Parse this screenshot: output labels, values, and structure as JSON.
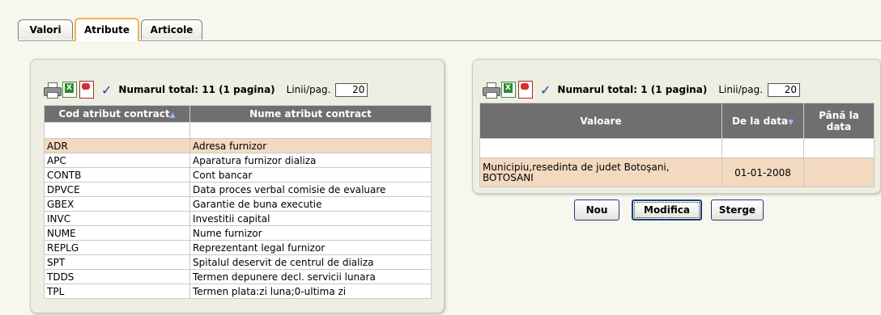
{
  "tabs": [
    {
      "label": "Valori",
      "active": false
    },
    {
      "label": "Atribute",
      "active": true
    },
    {
      "label": "Articole",
      "active": false
    }
  ],
  "left_panel": {
    "total_text": "Numarul total: 11 (1 pagina)",
    "lines_label": "Linii/pag.",
    "lines_value": "20",
    "columns": [
      "Cod atribut contract",
      "Nume atribut contract"
    ],
    "sort_icon": "sort-ascending-icon",
    "rows": [
      {
        "code": "ADR",
        "name": "Adresa furnizor",
        "selected": true
      },
      {
        "code": "APC",
        "name": "Aparatura furnizor dializa",
        "selected": false
      },
      {
        "code": "CONTB",
        "name": "Cont bancar",
        "selected": false
      },
      {
        "code": "DPVCE",
        "name": "Data proces verbal comisie de evaluare",
        "selected": false
      },
      {
        "code": "GBEX",
        "name": "Garantie de buna executie",
        "selected": false
      },
      {
        "code": "INVC",
        "name": "Investitii capital",
        "selected": false
      },
      {
        "code": "NUME",
        "name": "Nume furnizor",
        "selected": false
      },
      {
        "code": "REPLG",
        "name": "Reprezentant legal furnizor",
        "selected": false
      },
      {
        "code": "SPT",
        "name": "Spitalul deservit de centrul de dializa",
        "selected": false
      },
      {
        "code": "TDDS",
        "name": "Termen depunere decl. servicii lunara",
        "selected": false
      },
      {
        "code": "TPL",
        "name": "Termen plata:zi luna;0-ultima zi",
        "selected": false
      }
    ]
  },
  "right_panel": {
    "total_text": "Numarul total: 1 (1 pagina)",
    "lines_label": "Linii/pag.",
    "lines_value": "20",
    "columns": [
      "Valoare",
      "De la data",
      "Până la data"
    ],
    "sort_icon": "sort-descending-icon",
    "rows": [
      {
        "value_line1": "Municipiu,resedinta de judet Botoşani,",
        "value_line2": "BOTOSANI",
        "from": "01-01-2008",
        "to": ""
      }
    ]
  },
  "buttons": {
    "new": "Nou",
    "modify": "Modifica",
    "delete": "Sterge"
  },
  "icons": [
    "printer-icon",
    "excel-export-icon",
    "pdf-export-icon",
    "checkmark-icon"
  ],
  "colors": {
    "active_tab_border": "#f3b24c",
    "header_bg": "#6f6f6f",
    "selected_row": "#f2d9c0",
    "button_border": "#1a3c7a"
  }
}
